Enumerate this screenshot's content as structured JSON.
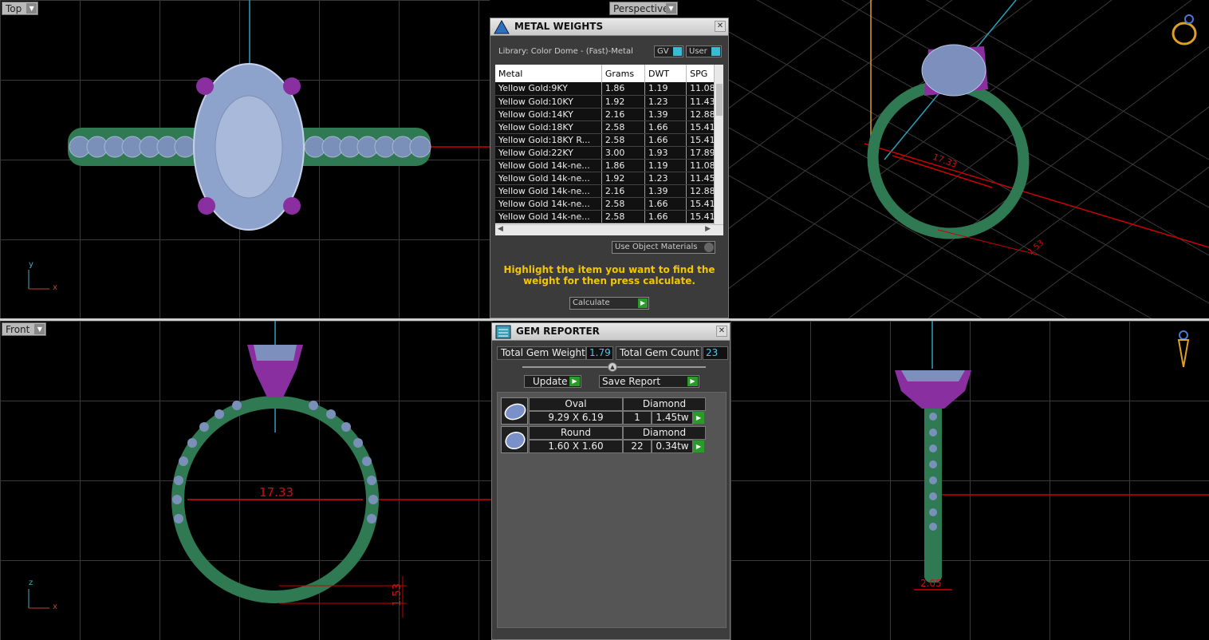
{
  "viewports": {
    "top": {
      "label": "Top"
    },
    "perspective": {
      "label": "Perspective"
    },
    "front": {
      "label": "Front"
    }
  },
  "dims": {
    "perspective_ring": "17.33",
    "perspective_small": "1.53",
    "front_ring": "17.33",
    "front_height": "1.53",
    "right_width": "2.05"
  },
  "axes": {
    "y": "y",
    "x": "x",
    "z": "z"
  },
  "metal_weights": {
    "title": "METAL WEIGHTS",
    "library": "Library: Color Dome - (Fast)-Metal",
    "gv_label": "GV",
    "user_label": "User",
    "columns": [
      "Metal",
      "Grams",
      "DWT",
      "SPG"
    ],
    "rows": [
      [
        "Yellow Gold:9KY",
        "1.86",
        "1.19",
        "11.08"
      ],
      [
        "Yellow Gold:10KY",
        "1.92",
        "1.23",
        "11.43"
      ],
      [
        "Yellow Gold:14KY",
        "2.16",
        "1.39",
        "12.88"
      ],
      [
        "Yellow Gold:18KY",
        "2.58",
        "1.66",
        "15.41"
      ],
      [
        "Yellow Gold:18KY R...",
        "2.58",
        "1.66",
        "15.41"
      ],
      [
        "Yellow Gold:22KY",
        "3.00",
        "1.93",
        "17.89"
      ],
      [
        "Yellow Gold 14k-ne...",
        "1.86",
        "1.19",
        "11.08"
      ],
      [
        "Yellow Gold 14k-ne...",
        "1.92",
        "1.23",
        "11.45"
      ],
      [
        "Yellow Gold 14k-ne...",
        "2.16",
        "1.39",
        "12.88"
      ],
      [
        "Yellow Gold 14k-ne...",
        "2.58",
        "1.66",
        "15.41"
      ],
      [
        "Yellow Gold 14k-ne...",
        "2.58",
        "1.66",
        "15.41"
      ]
    ],
    "use_object_materials": "Use Object Materials",
    "hint": "Highlight the item you want to find the weight for then press calculate.",
    "calculate": "Calculate"
  },
  "gem_reporter": {
    "title": "GEM REPORTER",
    "total_weight_label": "Total Gem Weight",
    "total_weight_value": "1.79",
    "total_count_label": "Total Gem Count",
    "total_count_value": "23",
    "update": "Update",
    "save_report": "Save Report",
    "gems": [
      {
        "shape": "Oval",
        "type": "Diamond",
        "size": "9.29 X 6.19",
        "count": "1",
        "weight": "1.45tw"
      },
      {
        "shape": "Round",
        "type": "Diamond",
        "size": "1.60 X 1.60",
        "count": "22",
        "weight": "0.34tw"
      }
    ]
  }
}
